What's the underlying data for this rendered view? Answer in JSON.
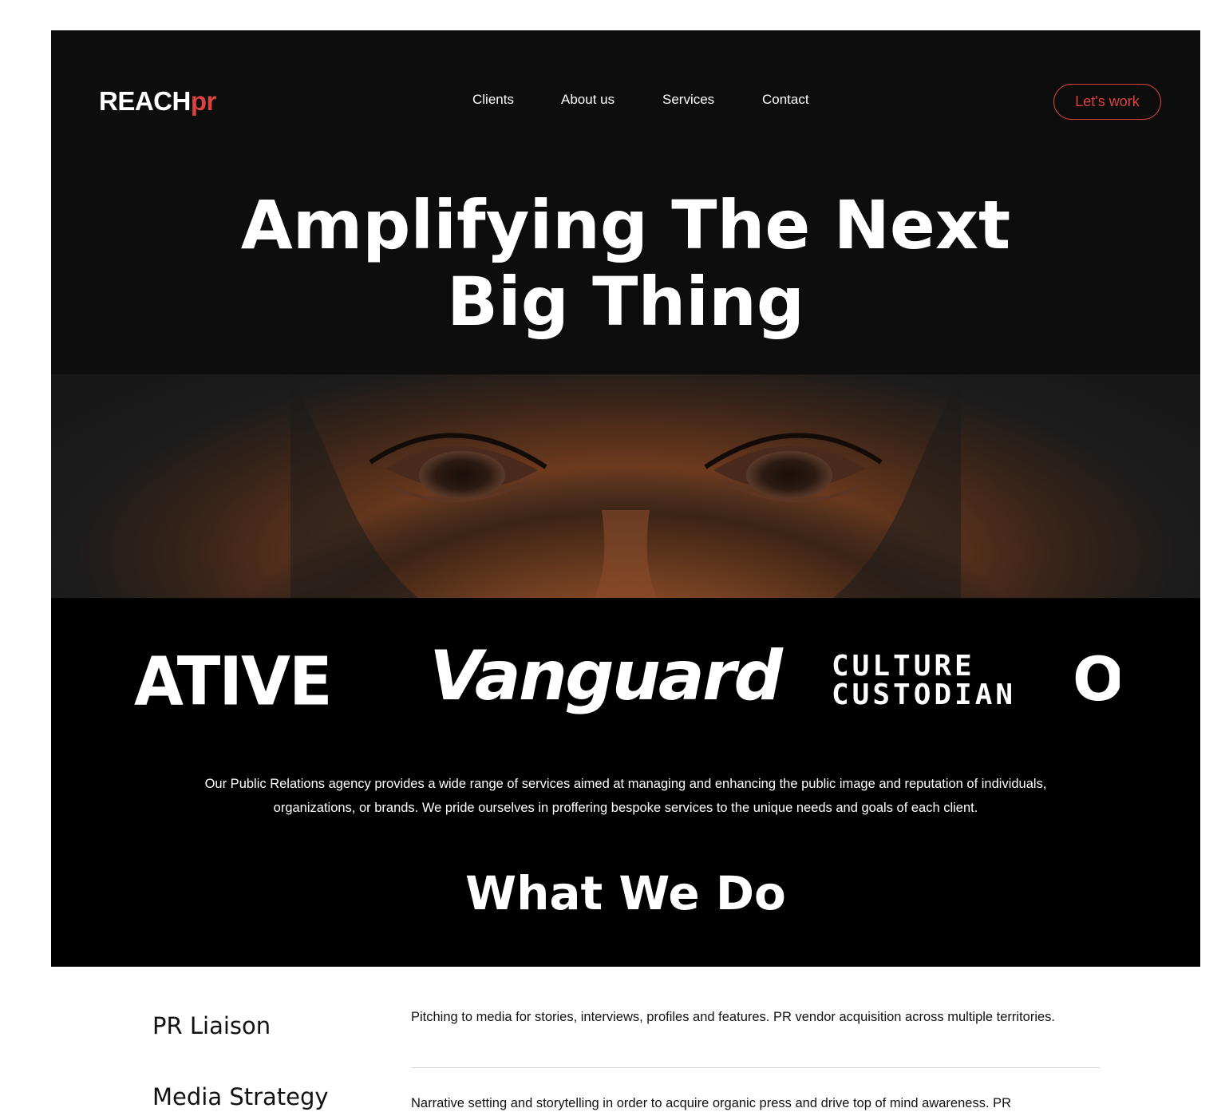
{
  "brand": {
    "name": "REACH",
    "suffix": "pr",
    "accent_color": "#d9433f"
  },
  "nav": {
    "items": [
      "Clients",
      "About us",
      "Services",
      "Contact"
    ]
  },
  "cta": {
    "label": "Let's work"
  },
  "hero": {
    "title_line1": "Amplifying The Next",
    "title_line2": "Big Thing",
    "image": "woman-eyes-closeup"
  },
  "client_logos": [
    "ATIVE",
    "Vanguard",
    "CULTURE",
    "CUSTODIAN",
    "O"
  ],
  "intro": {
    "text": "Our Public Relations agency provides a wide range of services aimed at managing and enhancing the public image and reputation of individuals, organizations, or brands. We pride ourselves in proffering bespoke services to the unique needs and goals of each client."
  },
  "what_we_do": {
    "title": "What We Do",
    "services": [
      {
        "name": "PR Liaison",
        "description": "Pitching to media for stories, interviews, profiles and features. PR vendor acquisition across multiple territories."
      },
      {
        "name": "Media Strategy",
        "description": "Narrative setting and storytelling in order to acquire organic press and drive top of mind awareness. PR"
      }
    ]
  }
}
